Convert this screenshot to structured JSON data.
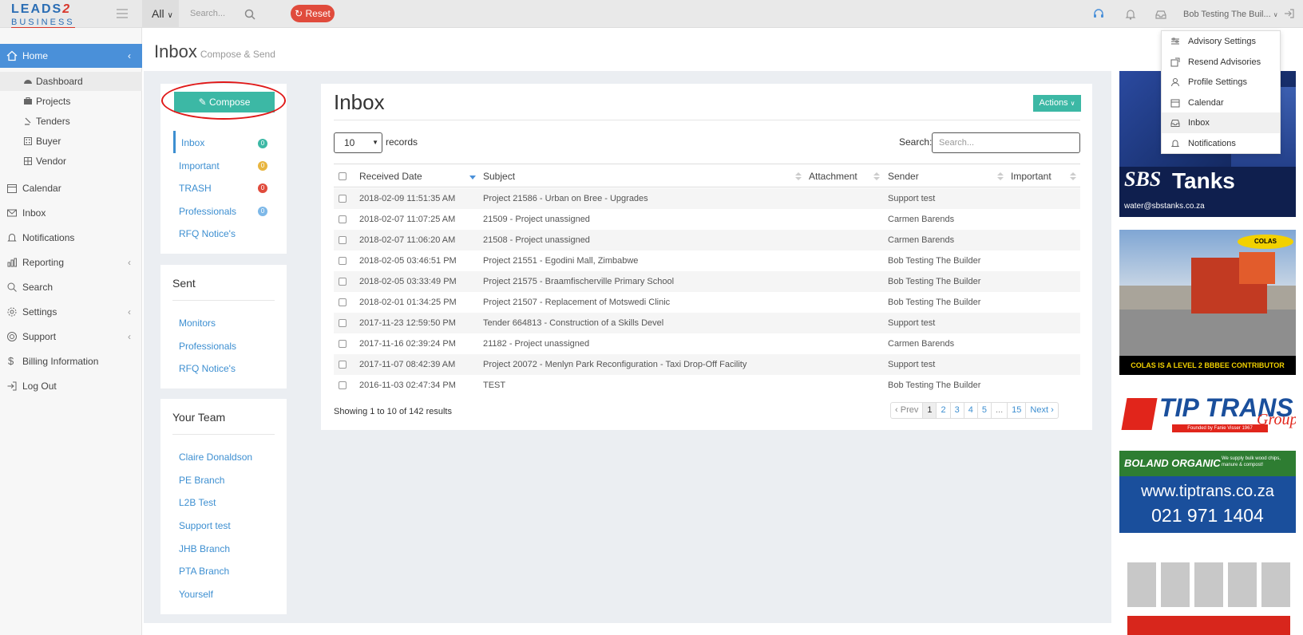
{
  "brand": {
    "logo_line1_a": "LEADS",
    "logo_line1_b": "2",
    "logo_line2": "BUSINESS"
  },
  "topbar": {
    "scope_selector": "All",
    "search_placeholder": "Search...",
    "reset_label": "Reset",
    "user_name": "Bob Testing The Buil..."
  },
  "sidebar": {
    "home": "Home",
    "sub_items": [
      "Dashboard",
      "Projects",
      "Tenders",
      "Buyer",
      "Vendor"
    ],
    "items": [
      "Calendar",
      "Inbox",
      "Notifications",
      "Reporting",
      "Search",
      "Settings",
      "Support",
      "Billing Information",
      "Log Out"
    ]
  },
  "page": {
    "title": "Inbox",
    "subtitle": "Compose & Send"
  },
  "folders": {
    "compose_label": "Compose",
    "items": [
      {
        "label": "Inbox",
        "count": "0",
        "color": "#3cb8a5"
      },
      {
        "label": "Important",
        "count": "0",
        "color": "#e8b53f"
      },
      {
        "label": "TRASH",
        "count": "0",
        "color": "#e04b3c"
      },
      {
        "label": "Professionals",
        "count": "0",
        "color": "#7db8e8"
      }
    ],
    "rfq": "RFQ Notice's"
  },
  "sent": {
    "heading": "Sent",
    "links": [
      "Monitors",
      "Professionals",
      "RFQ Notice's"
    ]
  },
  "team": {
    "heading": "Your Team",
    "links": [
      "Claire Donaldson",
      "PE Branch",
      "L2B Test",
      "Support test",
      "JHB Branch",
      "PTA Branch",
      "Yourself"
    ]
  },
  "inbox": {
    "heading": "Inbox",
    "actions_label": "Actions",
    "page_length": "10",
    "records_label": "records",
    "search_label": "Search:",
    "search_placeholder": "Search...",
    "columns": [
      "Received Date",
      "Subject",
      "Attachment",
      "Sender",
      "Important"
    ],
    "rows": [
      {
        "date": "2018-02-09 11:51:35 AM",
        "subject": "Project 21586 - Urban on Bree - Upgrades",
        "sender": "Support test"
      },
      {
        "date": "2018-02-07 11:07:25 AM",
        "subject": "21509 - Project unassigned",
        "sender": "Carmen Barends"
      },
      {
        "date": "2018-02-07 11:06:20 AM",
        "subject": "21508 - Project unassigned",
        "sender": "Carmen Barends"
      },
      {
        "date": "2018-02-05 03:46:51 PM",
        "subject": "Project 21551 - Egodini Mall, Zimbabwe",
        "sender": "Bob Testing The Builder"
      },
      {
        "date": "2018-02-05 03:33:49 PM",
        "subject": "Project 21575 - Braamfischerville Primary School",
        "sender": "Bob Testing The Builder"
      },
      {
        "date": "2018-02-01 01:34:25 PM",
        "subject": "Project 21507 - Replacement of Motswedi Clinic",
        "sender": "Bob Testing The Builder"
      },
      {
        "date": "2017-11-23 12:59:50 PM",
        "subject": "Tender 664813 - Construction of a Skills Devel",
        "sender": "Support test"
      },
      {
        "date": "2017-11-16 02:39:24 PM",
        "subject": "21182 - Project unassigned",
        "sender": "Carmen Barends"
      },
      {
        "date": "2017-11-07 08:42:39 AM",
        "subject": "Project 20072 - Menlyn Park Reconfiguration - Taxi Drop-Off Facility",
        "sender": "Support test"
      },
      {
        "date": "2016-11-03 02:47:34 PM",
        "subject": "TEST",
        "sender": "Bob Testing The Builder"
      }
    ],
    "showing": "Showing 1 to 10 of 142 results",
    "pager": [
      "Prev",
      "1",
      "2",
      "3",
      "4",
      "5",
      "...",
      "15",
      "Next"
    ]
  },
  "user_menu": [
    "Advisory Settings",
    "Resend Advisories",
    "Profile Settings",
    "Calendar",
    "Inbox",
    "Notifications"
  ],
  "ads": {
    "sbs_brand": "SBS",
    "sbs_product": "Tanks",
    "sbs_email": "water@sbstanks.co.za",
    "colas_logo": "COLAS",
    "colas_tagline": "COLAS IS A LEVEL 2 BBBEE CONTRIBUTOR",
    "tip_name": "TIP TRANS",
    "tip_group": "Group",
    "tip_founded": "Founded by Fanie Visser 1967",
    "boland": "BOLAND ORGANIC",
    "boland_note": "We supply bulk wood chips, manure & compost!",
    "tip_url": "www.tiptrans.co.za",
    "tip_phone": "021 971 1404"
  },
  "colors": {
    "primary": "#4a90d9",
    "teal": "#3cb8a5",
    "danger": "#e04b3c",
    "link": "#3d8fd1"
  }
}
